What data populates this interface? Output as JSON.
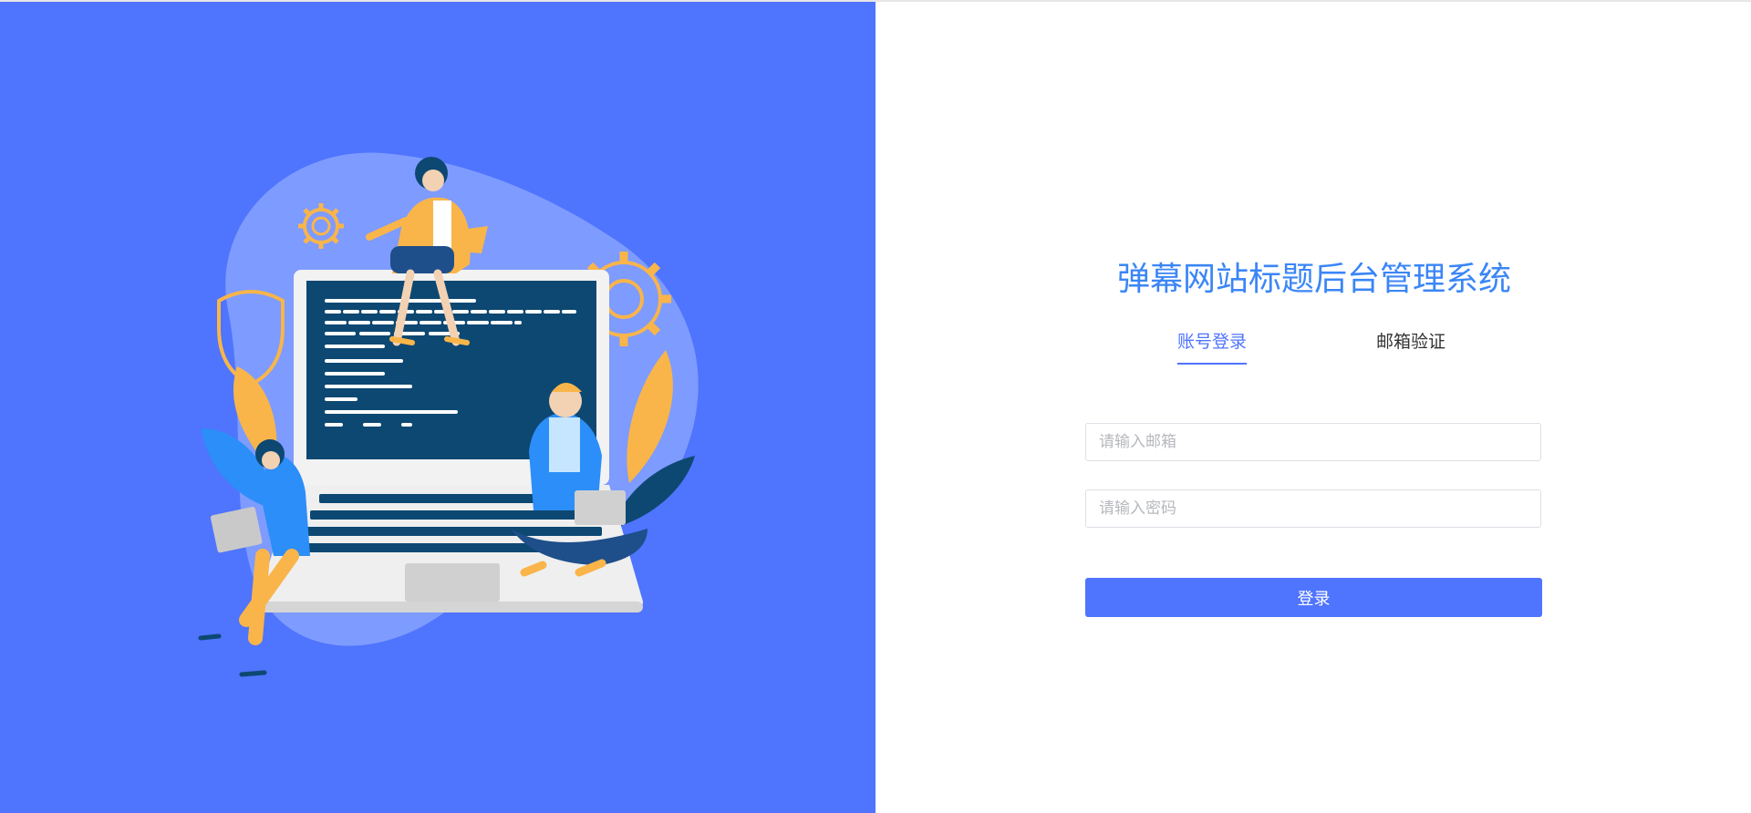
{
  "header": {
    "title": "弹幕网站标题后台管理系统"
  },
  "tabs": [
    {
      "label": "账号登录",
      "active": true
    },
    {
      "label": "邮箱验证",
      "active": false
    }
  ],
  "form": {
    "email_placeholder": "请输入邮箱",
    "email_value": "",
    "password_placeholder": "请输入密码",
    "password_value": "",
    "login_label": "登录"
  },
  "colors": {
    "brand_blue": "#4f74fd",
    "title_blue": "#3b86f6",
    "illustration_dark": "#0d4872",
    "illustration_orange": "#f9b54a"
  },
  "illustration": {
    "icons": [
      "gear-icon",
      "shield-icon",
      "laptop-icon",
      "people-icon"
    ]
  }
}
